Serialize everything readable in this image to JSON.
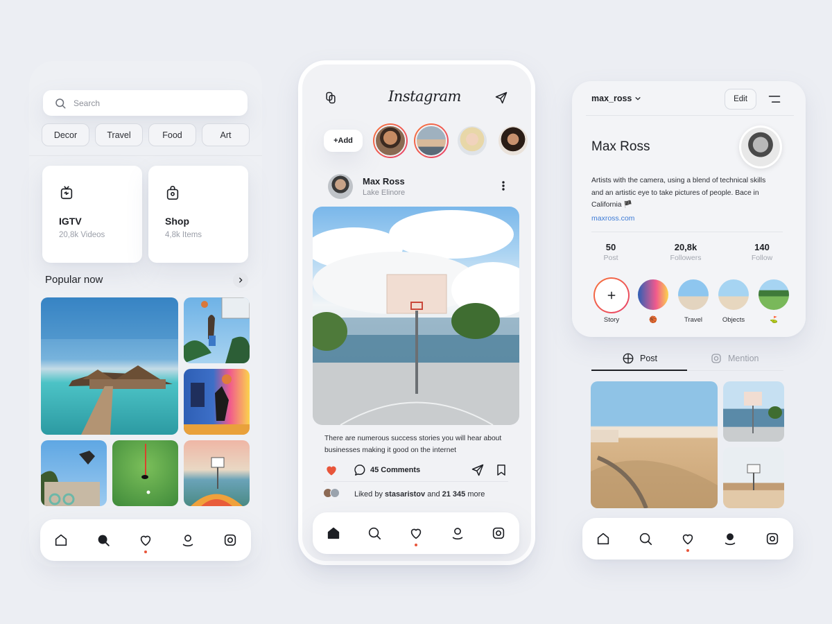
{
  "explore": {
    "search_placeholder": "Search",
    "chips": [
      "Decor",
      "Travel",
      "Food",
      "Art"
    ],
    "tiles": [
      {
        "title": "IGTV",
        "subtitle": "20,8k Videos",
        "icon": "tv-icon"
      },
      {
        "title": "Shop",
        "subtitle": "4,8k Items",
        "icon": "shopping-bag-icon"
      }
    ],
    "popular_title": "Popular now"
  },
  "feed": {
    "brand": "Instagram",
    "add_label": "+Add",
    "post": {
      "author": "Max Ross",
      "location": "Lake Elinore",
      "caption": "There are numerous success stories you will hear about businesses making it good on the internet",
      "comments_label": "45 Comments",
      "liked_prefix": "Liked by",
      "liked_user": "stasaristov",
      "liked_and": "and",
      "liked_count": "21 345",
      "liked_suffix": "more"
    }
  },
  "profile": {
    "username": "max_ross",
    "edit_label": "Edit",
    "name": "Max Ross",
    "bio": "Artists with the camera, using a blend of technical skills and an artistic eye to take pictures of people. Bace in California 🏴",
    "link": "maxross.com",
    "stats": [
      {
        "value": "50",
        "label": "Post"
      },
      {
        "value": "20,8k",
        "label": "Followers"
      },
      {
        "value": "140",
        "label": "Follow"
      }
    ],
    "highlights": [
      {
        "label": "Story"
      },
      {
        "label": "🏀"
      },
      {
        "label": "Travel"
      },
      {
        "label": "Objects"
      },
      {
        "label": "⛳"
      }
    ],
    "tabs": [
      {
        "label": "Post",
        "icon": "grid-icon"
      },
      {
        "label": "Mention",
        "icon": "mention-icon"
      }
    ]
  },
  "colors": {
    "accent": "#e8553a",
    "link": "#3d7bd6",
    "background": "#eceef3"
  }
}
